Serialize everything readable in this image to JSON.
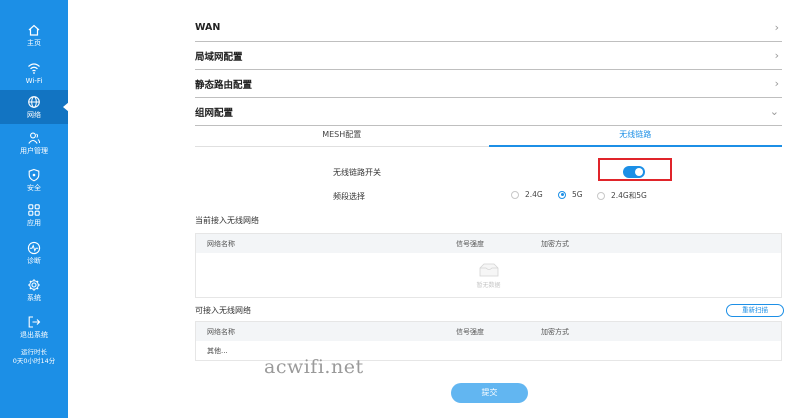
{
  "sidebar": {
    "items": [
      {
        "label": "主页",
        "icon": "home-icon"
      },
      {
        "label": "Wi-Fi",
        "icon": "wifi-icon"
      },
      {
        "label": "网络",
        "icon": "globe-icon"
      },
      {
        "label": "用户管理",
        "icon": "users-icon"
      },
      {
        "label": "安全",
        "icon": "shield-icon"
      },
      {
        "label": "应用",
        "icon": "apps-icon"
      },
      {
        "label": "诊断",
        "icon": "pulse-icon"
      },
      {
        "label": "系统",
        "icon": "gear-icon"
      },
      {
        "label": "退出系统",
        "icon": "logout-icon"
      }
    ],
    "active_index": 2,
    "uptime_label": "运行时长",
    "uptime_value": "0天0小时14分"
  },
  "sections": {
    "wan": "WAN",
    "lan": "局域网配置",
    "static_route": "静态路由配置",
    "mesh": "组网配置"
  },
  "tabs": [
    {
      "label": "MESH配置",
      "active": false
    },
    {
      "label": "无线链路",
      "active": true
    }
  ],
  "form": {
    "switch_label": "无线链路开关",
    "switch_on": true,
    "band_label": "频段选择",
    "band_options": [
      "2.4G",
      "5G",
      "2.4G和5G"
    ],
    "band_selected": "5G"
  },
  "current_networks": {
    "title": "当前接入无线网络",
    "columns": [
      "网络名称",
      "信号强度",
      "加密方式"
    ],
    "empty_text": "暂无数据"
  },
  "available_networks": {
    "title": "可接入无线网络",
    "rescan_label": "重新扫描",
    "columns": [
      "网络名称",
      "信号强度",
      "加密方式"
    ],
    "rows": [
      [
        "其他...",
        "",
        ""
      ]
    ]
  },
  "submit_label": "提交",
  "watermark": "acwifi.net",
  "colors": {
    "sidebar": "#1c8fe6",
    "sidebar_active": "#1274c2",
    "accent": "#1c8fe6",
    "highlight": "#e0242a"
  }
}
